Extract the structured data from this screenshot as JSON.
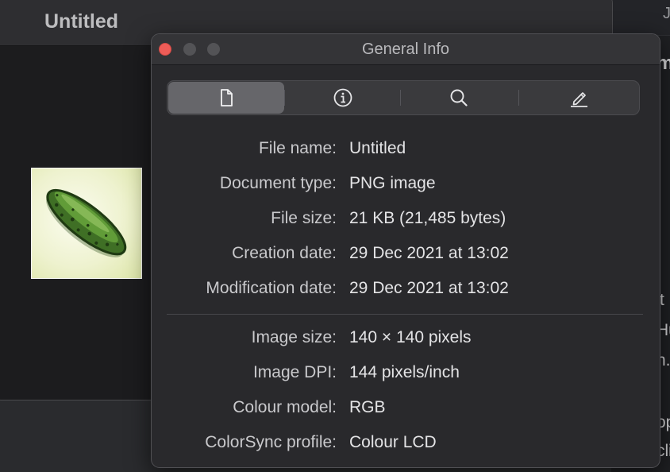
{
  "background_window": {
    "title": "Untitled"
  },
  "background_page": {
    "fragments": [
      "J",
      "m",
      "t",
      "Hu",
      "n.",
      "op",
      "cli"
    ]
  },
  "info_window": {
    "title": "General Info",
    "tabs": [
      {
        "icon": "document-icon",
        "active": true
      },
      {
        "icon": "info-icon",
        "active": false
      },
      {
        "icon": "search-icon",
        "active": false
      },
      {
        "icon": "pencil-icon",
        "active": false
      }
    ],
    "file_info": [
      {
        "label": "File name:",
        "value": "Untitled"
      },
      {
        "label": "Document type:",
        "value": "PNG image"
      },
      {
        "label": "File size:",
        "value": "21 KB (21,485 bytes)"
      },
      {
        "label": "Creation date:",
        "value": "29 Dec 2021 at 13:02"
      },
      {
        "label": "Modification date:",
        "value": "29 Dec 2021 at 13:02"
      }
    ],
    "image_info": [
      {
        "label": "Image size:",
        "value": "140 × 140 pixels"
      },
      {
        "label": "Image DPI:",
        "value": "144 pixels/inch"
      },
      {
        "label": "Colour model:",
        "value": "RGB"
      },
      {
        "label": "ColorSync profile:",
        "value": "Colour LCD"
      }
    ]
  },
  "colors": {
    "close_button": "#ee5c57",
    "pickle_green": "#4f8a2c"
  }
}
